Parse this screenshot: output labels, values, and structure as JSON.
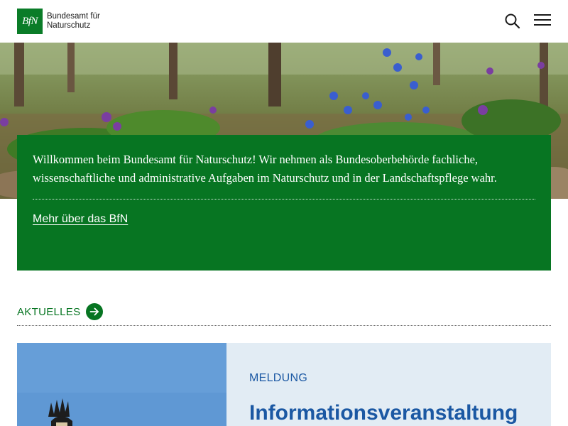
{
  "header": {
    "logo_mark": "BfN",
    "logo_line1": "Bundesamt für",
    "logo_line2": "Naturschutz",
    "search_icon": "search-icon",
    "menu_icon": "hamburger-menu-icon"
  },
  "hero": {
    "image": "forest-floor-blue-flowers"
  },
  "intro": {
    "text": "Willkommen beim Bundesamt für Naturschutz! Wir nehmen als Bundesoberbehörde fachliche, wissenschaftliche und administrative Aufgaben im Naturschutz und in der Landschaftspflege wahr.",
    "link": "Mehr über das BfN"
  },
  "aktuelles": {
    "label": "AKTUELLES",
    "icon": "arrow-right-icon"
  },
  "news": {
    "kicker": "MELDUNG",
    "title": "Informationsveranstaltung"
  },
  "colors": {
    "brand_green": "#077522",
    "news_blue": "#1b58a3",
    "card_bg": "#e2ecf4"
  }
}
